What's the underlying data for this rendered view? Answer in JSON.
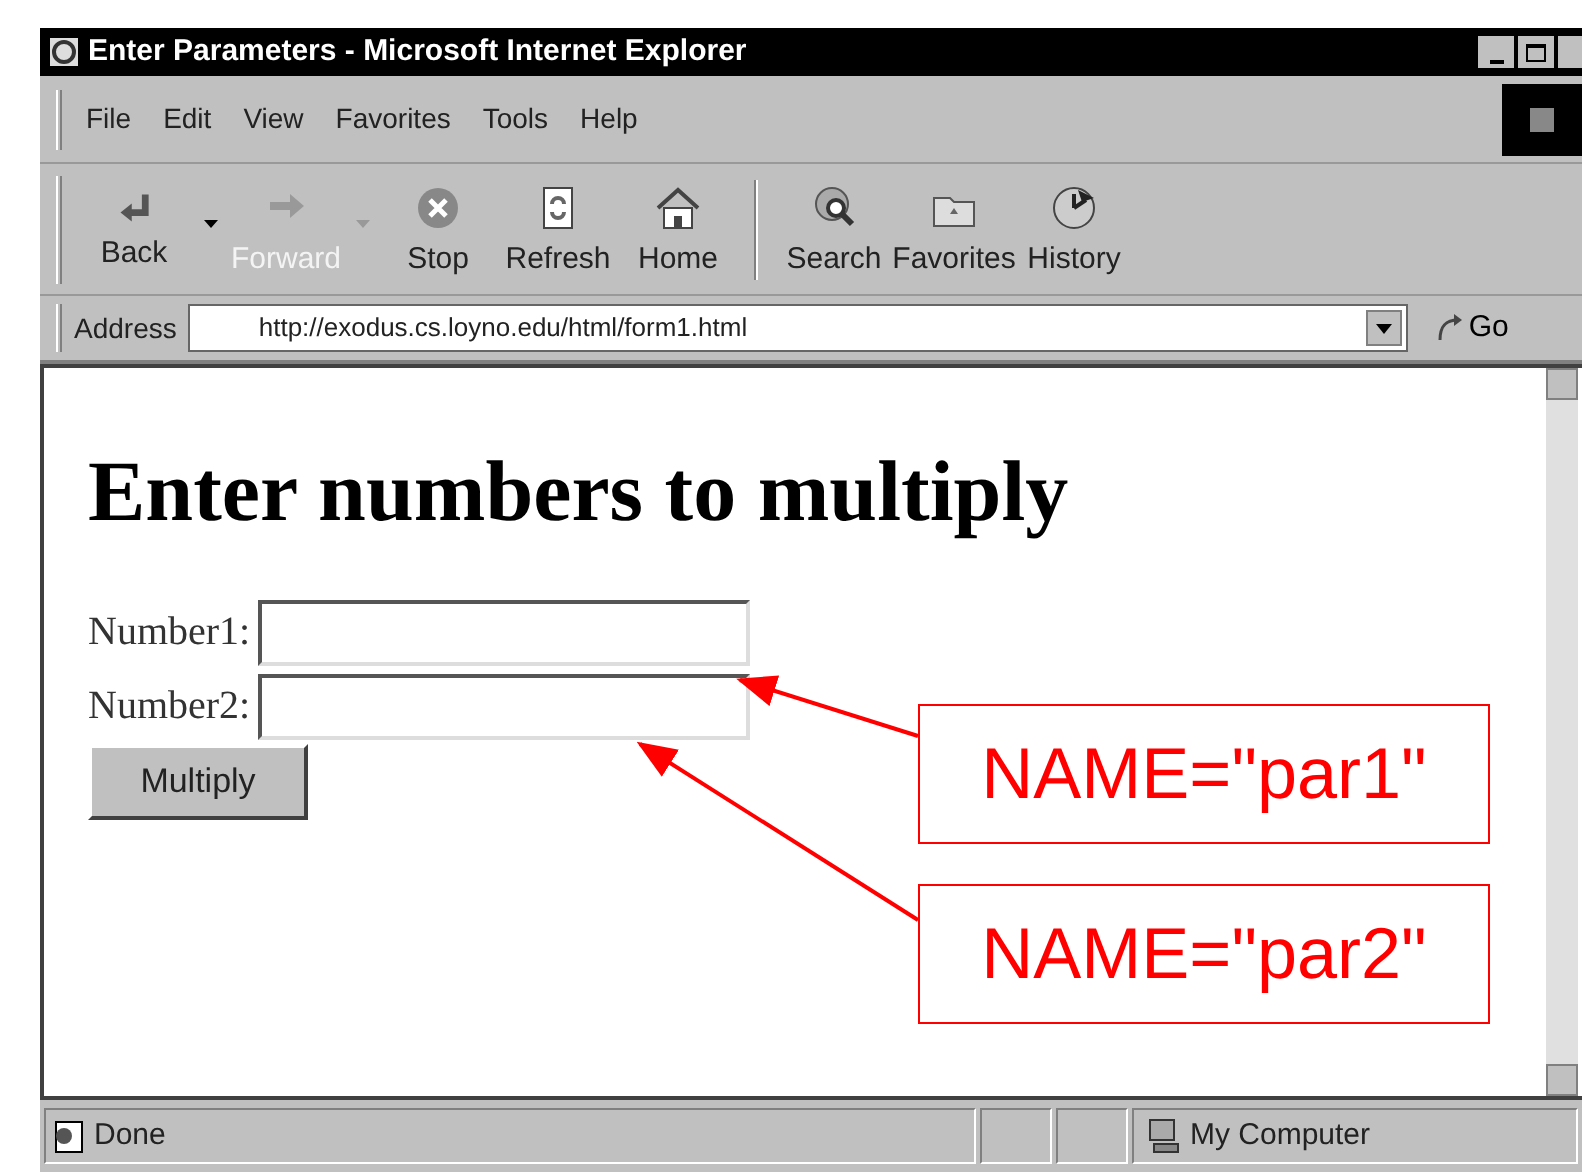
{
  "window": {
    "title": "Enter Parameters - Microsoft Internet Explorer"
  },
  "menu": [
    "File",
    "Edit",
    "View",
    "Favorites",
    "Tools",
    "Help"
  ],
  "toolbar": [
    {
      "kind": "back",
      "label": "Back",
      "disabled": false,
      "dropdown": true
    },
    {
      "kind": "forward",
      "label": "Forward",
      "disabled": true,
      "dropdown": true
    },
    {
      "kind": "stop",
      "label": "Stop",
      "disabled": false,
      "dropdown": false
    },
    {
      "kind": "refresh",
      "label": "Refresh",
      "disabled": false,
      "dropdown": false
    },
    {
      "kind": "home",
      "label": "Home",
      "disabled": false,
      "dropdown": false
    },
    {
      "kind": "search",
      "label": "Search",
      "disabled": false,
      "dropdown": false
    },
    {
      "kind": "favorites",
      "label": "Favorites",
      "disabled": false,
      "dropdown": false
    },
    {
      "kind": "history",
      "label": "History",
      "disabled": false,
      "dropdown": false
    }
  ],
  "address": {
    "label": "Address",
    "value": "http://exodus.cs.loyno.edu/html/form1.html",
    "go": "Go"
  },
  "page": {
    "heading": "Enter numbers to multiply",
    "fields": [
      {
        "label": "Number1:"
      },
      {
        "label": "Number2:"
      }
    ],
    "button": "Multiply"
  },
  "annotations": [
    {
      "text": "NAME=\"par1\""
    },
    {
      "text": "NAME=\"par2\""
    }
  ],
  "status_bar": {
    "text": "Done",
    "zone": "My Computer"
  }
}
